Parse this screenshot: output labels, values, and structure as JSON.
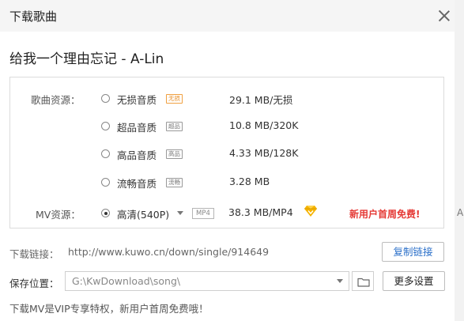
{
  "dialog": {
    "title": "下载歌曲",
    "song_title": "给我一个理由忘记 - A-Lin"
  },
  "song_source": {
    "label": "歌曲资源：",
    "options": [
      {
        "quality": "无损音质",
        "badge": "无损",
        "size": "29.1 MB/无损",
        "selected": false
      },
      {
        "quality": "超品音质",
        "badge": "超品",
        "size": "10.8 MB/320K",
        "selected": false
      },
      {
        "quality": "高品音质",
        "badge": "高品",
        "size": "4.33 MB/128K",
        "selected": false
      },
      {
        "quality": "流畅音质",
        "badge": "流畅",
        "size": "3.28 MB",
        "selected": false
      }
    ]
  },
  "mv_source": {
    "label": "MV资源：",
    "selected_value": "高清(540P)",
    "format_tag": "MP4",
    "size": "38.3 MB/MP4",
    "promo": "新用户首周免费!",
    "selected": true
  },
  "download_link": {
    "label": "下载链接：",
    "url": "http://www.kuwo.cn/down/single/914649",
    "copy_button": "复制链接"
  },
  "save_location": {
    "label": "保存位置：",
    "path": "G:\\KwDownload\\song\\",
    "more_settings_button": "更多设置"
  },
  "footer_note": "下载MV是VIP专享特权，新用户首周免费哦！",
  "side_fragment": "A",
  "colors": {
    "promo_red": "#e53935",
    "link_blue": "#2a6fc9",
    "vip_gold": "#f5b301"
  },
  "icons": {
    "close": "close-icon",
    "folder": "folder-icon",
    "vip": "vip-diamond-icon",
    "dropdown": "chevron-down-icon"
  }
}
